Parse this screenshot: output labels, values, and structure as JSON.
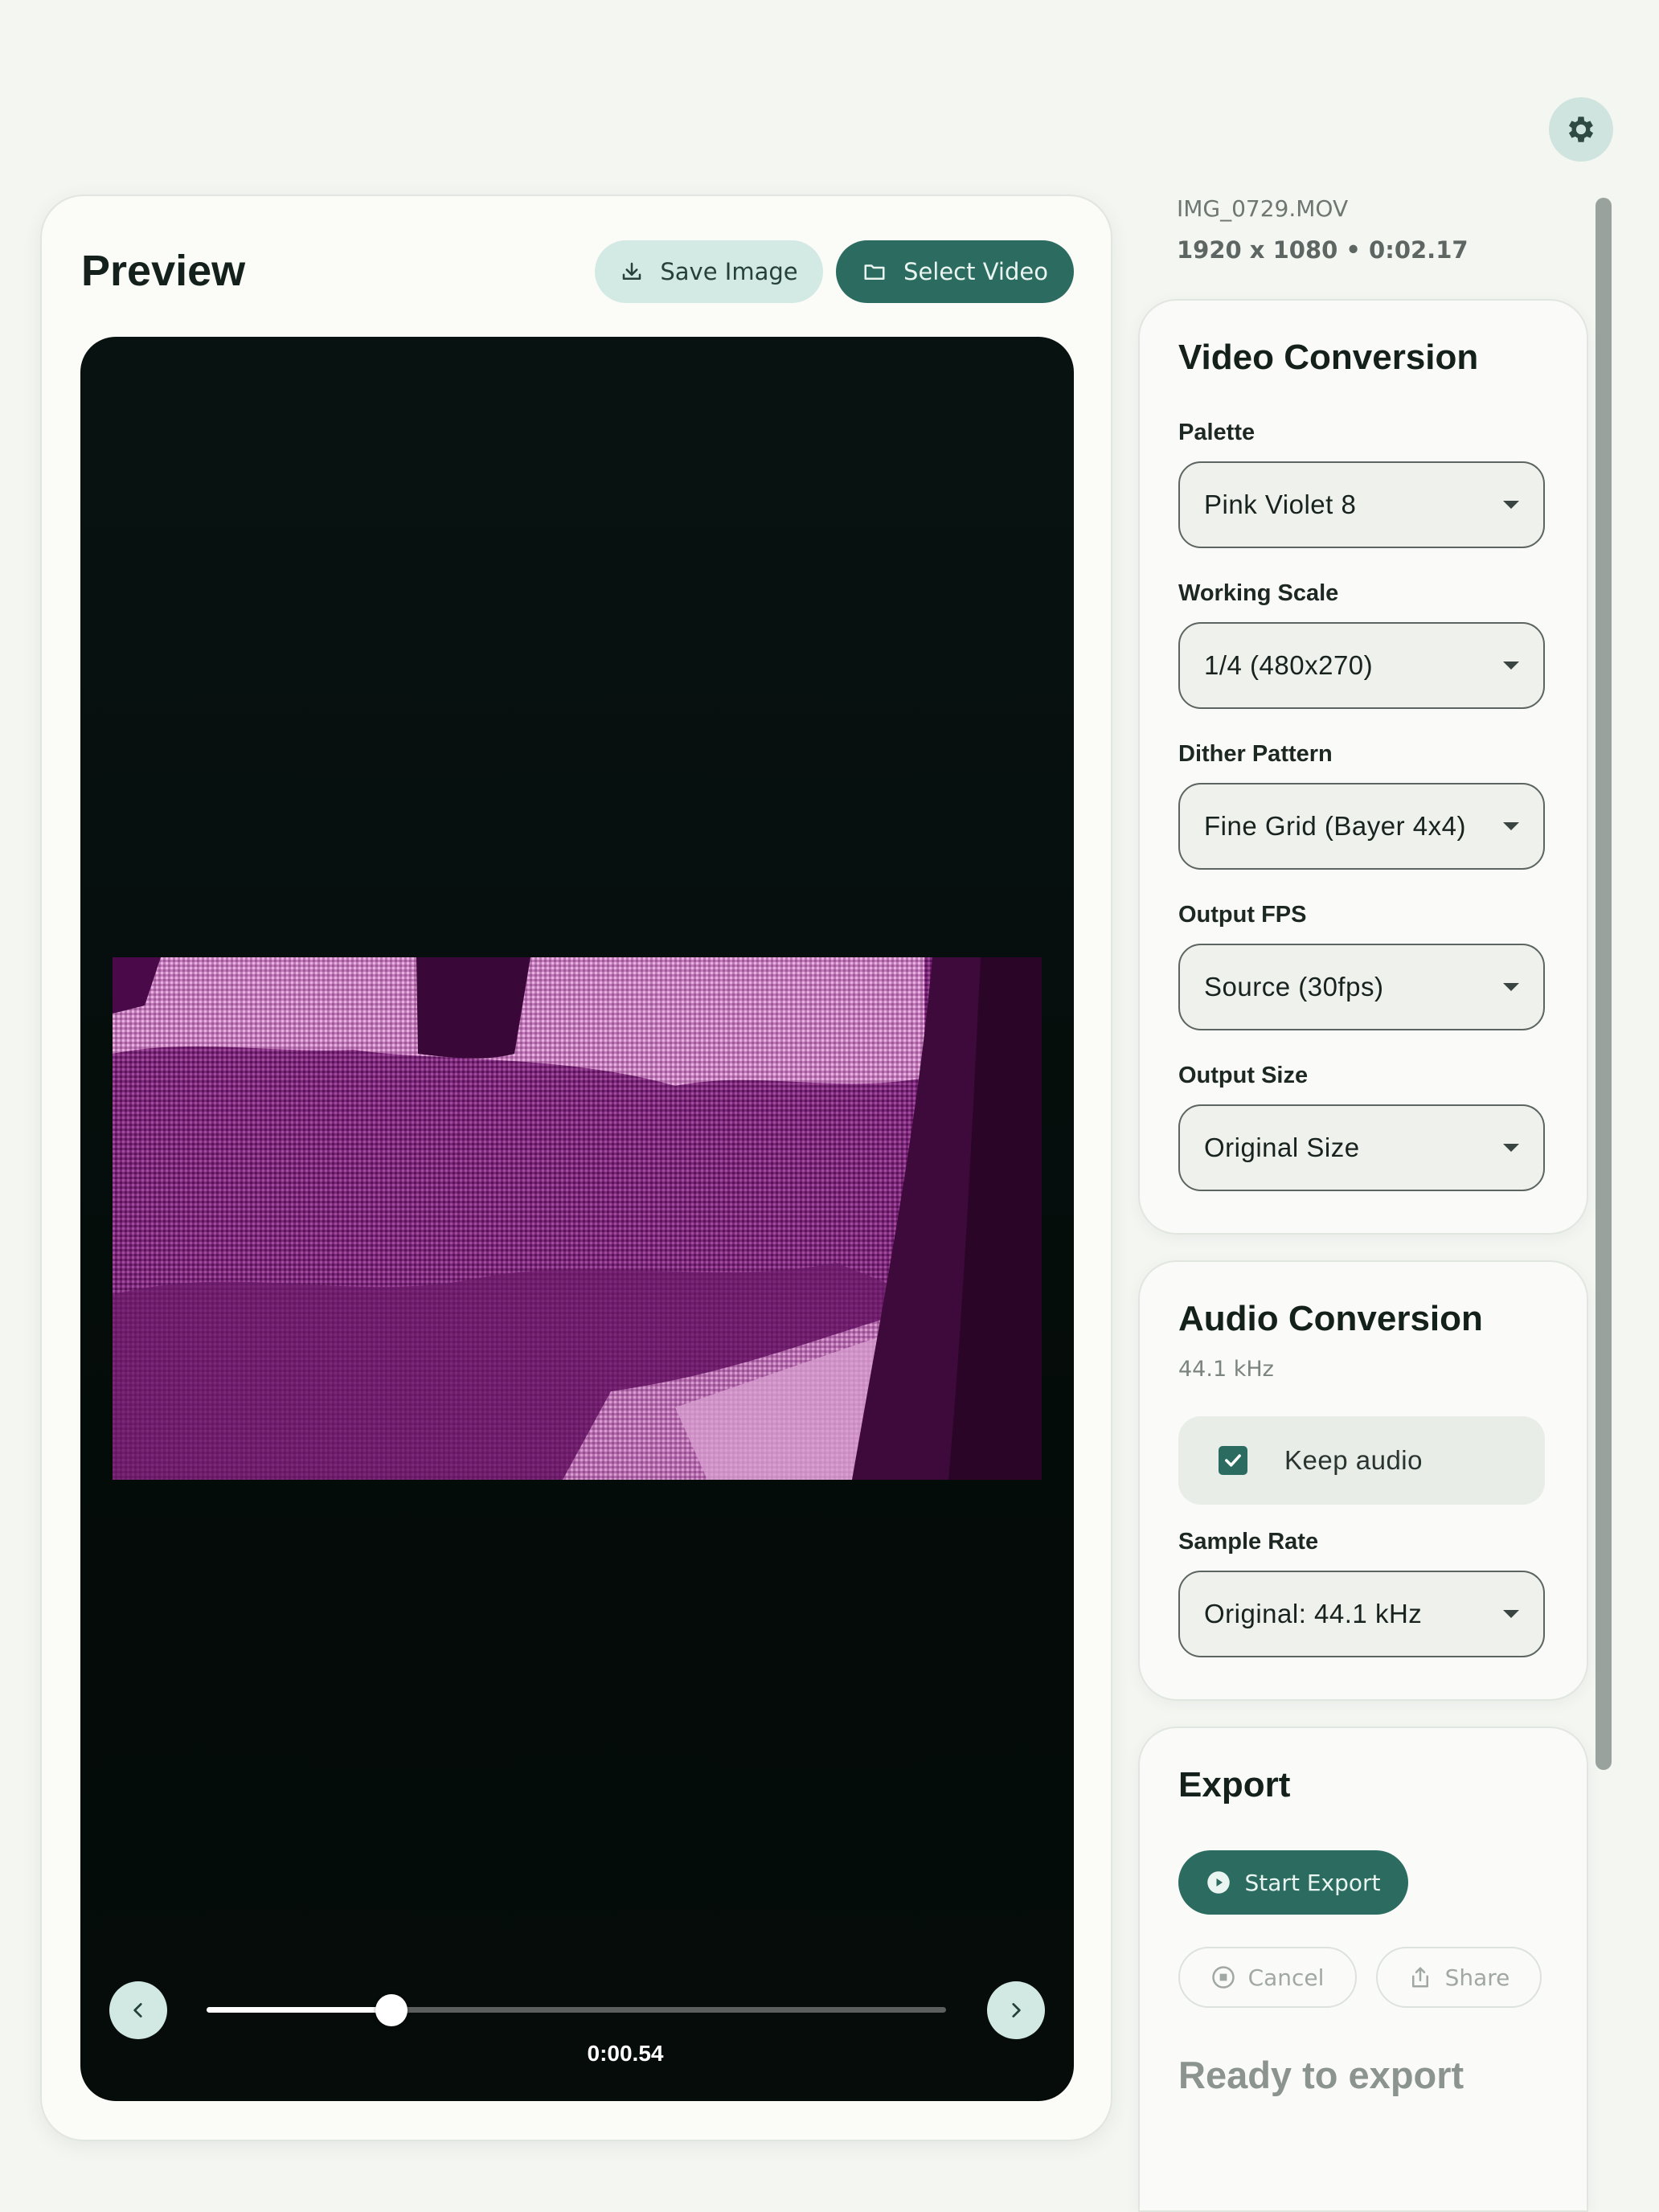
{
  "header": {
    "settings_icon": "gear-icon"
  },
  "preview": {
    "title": "Preview",
    "save_image_label": "Save Image",
    "select_video_label": "Select Video",
    "timestamp": "0:00.54",
    "progress": 0.25
  },
  "file": {
    "name": "IMG_0729.MOV",
    "meta": "1920 x 1080 • 0:02.17"
  },
  "video_conversion": {
    "title": "Video Conversion",
    "palette_label": "Palette",
    "palette_value": "Pink Violet 8",
    "scale_label": "Working Scale",
    "scale_value": "1/4 (480x270)",
    "dither_label": "Dither Pattern",
    "dither_value": "Fine Grid (Bayer 4x4)",
    "fps_label": "Output FPS",
    "fps_value": "Source (30fps)",
    "size_label": "Output Size",
    "size_value": "Original Size"
  },
  "audio_conversion": {
    "title": "Audio Conversion",
    "subtitle": "44.1 kHz",
    "keep_audio_label": "Keep audio",
    "keep_audio_checked": true,
    "sample_rate_label": "Sample Rate",
    "sample_rate_value": "Original: 44.1 kHz"
  },
  "export": {
    "title": "Export",
    "start_label": "Start Export",
    "cancel_label": "Cancel",
    "share_label": "Share",
    "status": "Ready to export"
  },
  "colors": {
    "accent": "#2c6c60",
    "accent_light": "#d3e9e3",
    "background": "#f4f6f2",
    "frame_dark": "#4a0a4a",
    "frame_light": "#e6a6dc"
  }
}
